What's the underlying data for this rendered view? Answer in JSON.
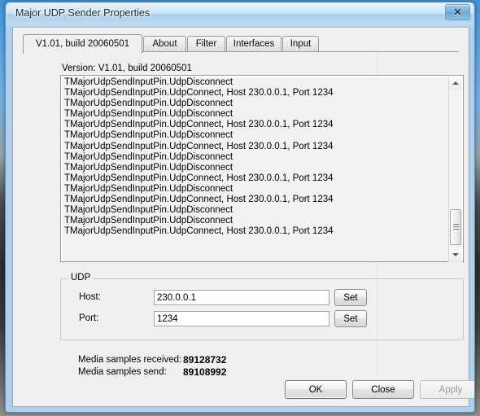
{
  "window": {
    "title": "Major UDP Sender Properties",
    "close_glyph": "✕",
    "close_icon_name": "close-icon"
  },
  "tabs": [
    {
      "label": "V1.01, build 20060501",
      "selected": true
    },
    {
      "label": "About",
      "selected": false
    },
    {
      "label": "Filter",
      "selected": false
    },
    {
      "label": "Interfaces",
      "selected": false
    },
    {
      "label": "Input",
      "selected": false
    }
  ],
  "page": {
    "version_label": "Version: V1.01, build 20060501",
    "log_lines": [
      "TMajorUdpSendInputPin.UdpDisconnect",
      "TMajorUdpSendInputPin.UdpConnect, Host 230.0.0.1, Port 1234",
      "TMajorUdpSendInputPin.UdpDisconnect",
      "TMajorUdpSendInputPin.UdpDisconnect",
      "TMajorUdpSendInputPin.UdpConnect, Host 230.0.0.1, Port 1234",
      "TMajorUdpSendInputPin.UdpDisconnect",
      "TMajorUdpSendInputPin.UdpConnect, Host 230.0.0.1, Port 1234",
      "TMajorUdpSendInputPin.UdpDisconnect",
      "TMajorUdpSendInputPin.UdpDisconnect",
      "TMajorUdpSendInputPin.UdpConnect, Host 230.0.0.1, Port 1234",
      "TMajorUdpSendInputPin.UdpDisconnect",
      "TMajorUdpSendInputPin.UdpConnect, Host 230.0.0.1, Port 1234",
      "TMajorUdpSendInputPin.UdpDisconnect",
      "TMajorUdpSendInputPin.UdpDisconnect",
      "TMajorUdpSendInputPin.UdpConnect, Host 230.0.0.1, Port 1234"
    ]
  },
  "udp": {
    "legend": "UDP",
    "host_label": "Host:",
    "host_value": "230.0.0.1",
    "host_placeholder": "",
    "host_set_label": "Set",
    "port_label": "Port:",
    "port_value": "1234",
    "port_placeholder": "",
    "port_set_label": "Set"
  },
  "stats": {
    "received_label": "Media samples received:",
    "received_value": "89128732",
    "send_label": "Media samples send:",
    "send_value": "89108992"
  },
  "buttons": {
    "ok": "OK",
    "close": "Close",
    "apply": "Apply",
    "apply_disabled": true
  },
  "colors": {
    "titlebar_accent": "#aed0ec",
    "window_border": "#5a8fc0",
    "client_background": "#f0f0f0",
    "input_background": "#ffffff",
    "text": "#000000"
  },
  "scrollbar": {
    "up_icon_name": "scroll-up-arrow-icon",
    "down_icon_name": "scroll-down-arrow-icon"
  }
}
